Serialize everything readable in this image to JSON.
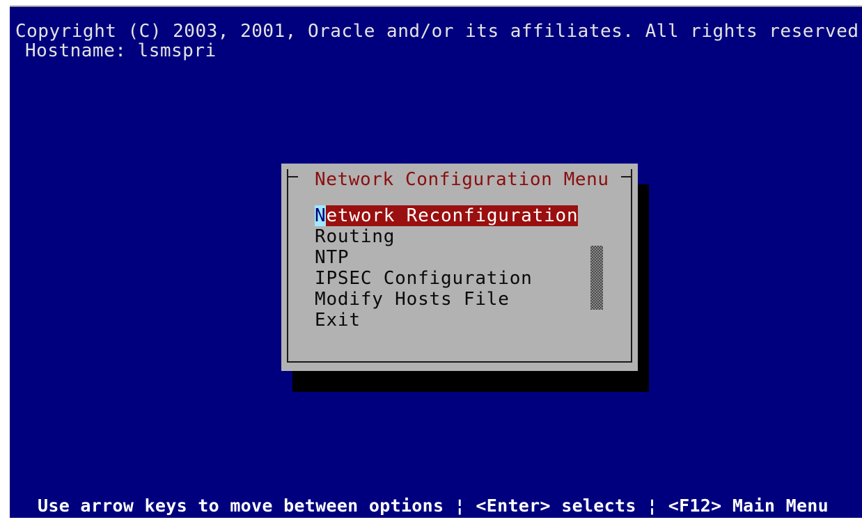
{
  "terminal": {
    "copyright": "Copyright (C) 2003, 2001, Oracle and/or its affiliates. All rights reserved.",
    "hostname_label": "Hostname:",
    "hostname_value": "lsmspri"
  },
  "dialog": {
    "title": "Network Configuration Menu",
    "items": [
      {
        "hotkey": "N",
        "rest": "etwork Reconfiguration",
        "label": "Network Reconfiguration",
        "selected": true
      },
      {
        "hotkey": "",
        "rest": "Routing",
        "label": "Routing",
        "selected": false
      },
      {
        "hotkey": "",
        "rest": "NTP",
        "label": "NTP",
        "selected": false
      },
      {
        "hotkey": "",
        "rest": "IPSEC Configuration",
        "label": "IPSEC Configuration",
        "selected": false
      },
      {
        "hotkey": "",
        "rest": "Modify Hosts File",
        "label": "Modify Hosts File",
        "selected": false
      },
      {
        "hotkey": "",
        "rest": "Exit",
        "label": "Exit",
        "selected": false
      }
    ]
  },
  "status_bar": {
    "text": "Use arrow keys to move between options ¦ <Enter> selects ¦ <F12> Main Menu"
  },
  "colors": {
    "background": "#00007e",
    "dialog_bg": "#b2b2b2",
    "title": "#8b0d0d",
    "selection_bg": "#9a0f0f",
    "cursor_bg": "#9fe8ff"
  }
}
